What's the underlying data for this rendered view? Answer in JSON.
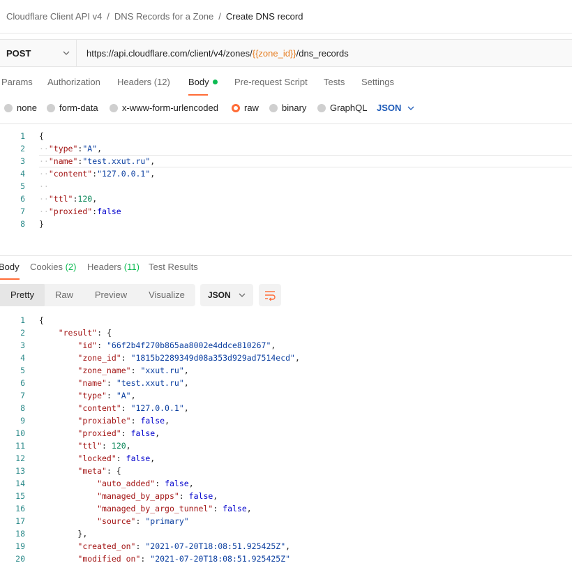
{
  "breadcrumb": {
    "items": [
      "Cloudflare Client API v4",
      "DNS Records for a Zone"
    ],
    "current": "Create DNS record",
    "separator": "/"
  },
  "request": {
    "method": "POST",
    "url_prefix": "https://api.cloudflare.com/client/v4/zones/",
    "url_variable": "{{zone_id}}",
    "url_suffix": "/dns_records",
    "tabs": [
      {
        "label": "Params"
      },
      {
        "label": "Authorization"
      },
      {
        "label": "Headers (12)"
      },
      {
        "label": "Body",
        "active": true
      },
      {
        "label": "Pre-request Script"
      },
      {
        "label": "Tests"
      },
      {
        "label": "Settings"
      }
    ],
    "body_types": [
      "none",
      "form-data",
      "x-www-form-urlencoded",
      "raw",
      "binary",
      "GraphQL"
    ],
    "body_type_selected": "raw",
    "language": "JSON",
    "body_lines": [
      "{",
      "  \"type\":\"A\",",
      "  \"name\":\"test.xxut.ru\",",
      "  \"content\":\"127.0.0.1\",",
      "  ",
      "  \"ttl\":120,",
      "  \"proxied\":false",
      "}"
    ]
  },
  "response": {
    "tabs": {
      "body": "Body",
      "cookies": "Cookies",
      "cookies_count": "(2)",
      "headers": "Headers",
      "headers_count": "(11)",
      "test_results": "Test Results"
    },
    "view_modes": [
      "Pretty",
      "Raw",
      "Preview",
      "Visualize"
    ],
    "view_mode_active": "Pretty",
    "format": "JSON",
    "body_lines": [
      "{",
      "    \"result\": {",
      "        \"id\": \"66f2b4f270b865aa8002e4ddce810267\",",
      "        \"zone_id\": \"1815b2289349d08a353d929ad7514ecd\",",
      "        \"zone_name\": \"xxut.ru\",",
      "        \"name\": \"test.xxut.ru\",",
      "        \"type\": \"A\",",
      "        \"content\": \"127.0.0.1\",",
      "        \"proxiable\": false,",
      "        \"proxied\": false,",
      "        \"ttl\": 120,",
      "        \"locked\": false,",
      "        \"meta\": {",
      "            \"auto_added\": false,",
      "            \"managed_by_apps\": false,",
      "            \"managed_by_argo_tunnel\": false,",
      "            \"source\": \"primary\"",
      "        },",
      "        \"created_on\": \"2021-07-20T18:08:51.925425Z\",",
      "        \"modified_on\": \"2021-07-20T18:08:51.925425Z\""
    ]
  },
  "colors": {
    "accent": "#ff6c37",
    "status_green": "#0cbb52",
    "link_blue": "#1e5bb8",
    "variable_orange": "#e67e22"
  },
  "icons": [
    "chevron-down-icon",
    "wrap-lines-icon"
  ]
}
